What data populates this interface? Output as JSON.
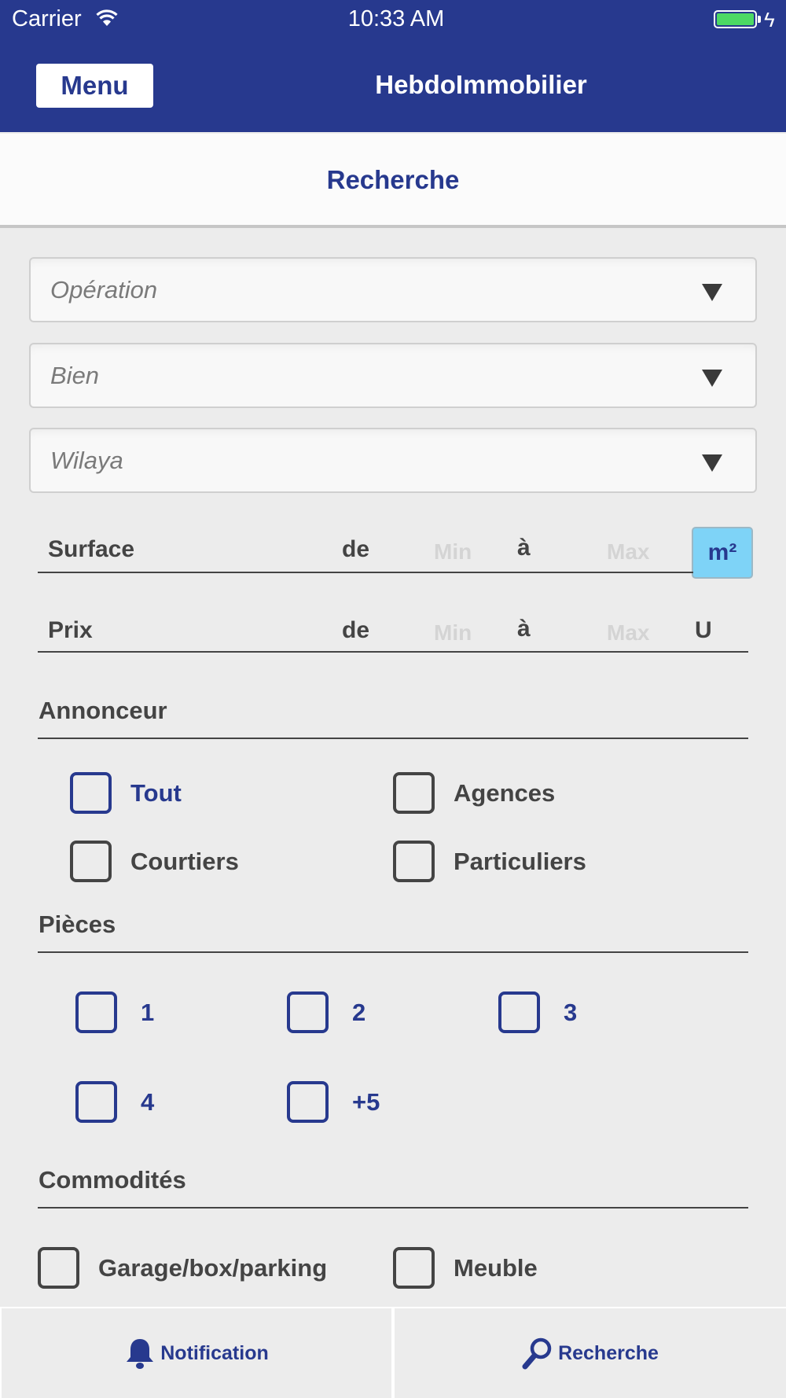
{
  "status_bar": {
    "carrier": "Carrier",
    "time": "10:33 AM"
  },
  "header": {
    "menu_label": "Menu",
    "title": "HebdoImmobilier"
  },
  "subheader": {
    "title": "Recherche"
  },
  "selects": [
    {
      "placeholder": "Opération"
    },
    {
      "placeholder": "Bien"
    },
    {
      "placeholder": "Wilaya"
    }
  ],
  "surface": {
    "label": "Surface",
    "from": "de",
    "min_placeholder": "Min",
    "to": "à",
    "max_placeholder": "Max",
    "unit": "m²"
  },
  "prix": {
    "label": "Prix",
    "from": "de",
    "min_placeholder": "Min",
    "to": "à",
    "max_placeholder": "Max",
    "unit": "U"
  },
  "annonceur": {
    "title": "Annonceur",
    "options": [
      "Tout",
      "Agences",
      "Courtiers",
      "Particuliers"
    ]
  },
  "pieces": {
    "title": "Pièces",
    "options": [
      "1",
      "2",
      "3",
      "4",
      "+5"
    ]
  },
  "commodites": {
    "title": "Commodités",
    "options": [
      "Garage/box/parking",
      "Meuble"
    ]
  },
  "tabbar": {
    "notification_label": "Notification",
    "search_label": "Recherche"
  },
  "colors": {
    "primary": "#27398e",
    "accent": "#7ed3f7",
    "background": "#ececec",
    "battery": "#4cd964"
  }
}
